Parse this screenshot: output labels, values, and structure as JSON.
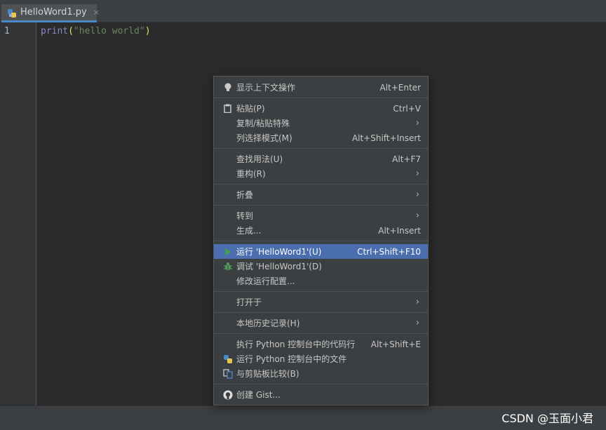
{
  "tab": {
    "label": "HelloWord1.py",
    "close": "×"
  },
  "gutter": {
    "line": "1"
  },
  "code": {
    "fn": "print",
    "open": "(",
    "str": "\"hello world\"",
    "close": ")"
  },
  "watermark": "CSDN @玉面小君",
  "menu": {
    "show_context": {
      "label": "显示上下文操作",
      "shortcut": "Alt+Enter",
      "icon": "lightbulb-icon"
    },
    "paste": {
      "label": "粘贴(P)",
      "shortcut": "Ctrl+V",
      "icon": "clipboard-icon"
    },
    "copy_paste_special": {
      "label": "复制/粘贴特殊",
      "arrow": "›"
    },
    "column_mode": {
      "label": "列选择模式(M)",
      "shortcut": "Alt+Shift+Insert"
    },
    "find_usages": {
      "label": "查找用法(U)",
      "shortcut": "Alt+F7"
    },
    "refactor": {
      "label": "重构(R)",
      "arrow": "›"
    },
    "folding": {
      "label": "折叠",
      "arrow": "›"
    },
    "goto": {
      "label": "转到",
      "arrow": "›"
    },
    "generate": {
      "label": "生成...",
      "shortcut": "Alt+Insert"
    },
    "run": {
      "label": "运行 'HelloWord1'(U)",
      "shortcut": "Ctrl+Shift+F10",
      "icon": "run-icon"
    },
    "debug": {
      "label": "调试 'HelloWord1'(D)",
      "icon": "debug-bug-icon"
    },
    "modify_run_config": {
      "label": "修改运行配置..."
    },
    "open_in": {
      "label": "打开于",
      "arrow": "›"
    },
    "local_history": {
      "label": "本地历史记录(H)",
      "arrow": "›"
    },
    "exec_line_console": {
      "label": "执行 Python 控制台中的代码行",
      "shortcut": "Alt+Shift+E"
    },
    "run_file_console": {
      "label": "运行 Python 控制台中的文件",
      "icon": "python-icon"
    },
    "compare_clipboard": {
      "label": "与剪贴板比较(B)",
      "icon": "compare-icon"
    },
    "create_gist": {
      "label": "创建 Gist...",
      "icon": "github-icon"
    }
  },
  "colors": {
    "accent": "#4b6eaf",
    "run_green": "#499c54",
    "bg": "#2b2b2b"
  }
}
